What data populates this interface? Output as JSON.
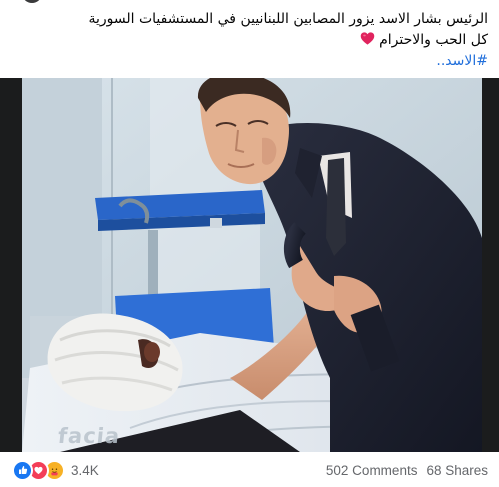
{
  "post": {
    "text_line_1": "الرئيس بشار الاسد يزور المصابين اللبنانيين في المستشفيات السورية",
    "text_line_2": "كل الحب والاحترام",
    "hashtag": "#الاسد..",
    "image_watermark": "facia"
  },
  "engagement": {
    "reaction_count": "3.4K",
    "comments": "502 Comments",
    "shares": "68 Shares",
    "reactions": [
      "like-icon",
      "love-icon",
      "care-icon"
    ]
  },
  "colors": {
    "link": "#216fdb",
    "like": "#1877f2",
    "love": "#f33e58",
    "care": "#f7b125",
    "meta_text": "#65676b"
  }
}
